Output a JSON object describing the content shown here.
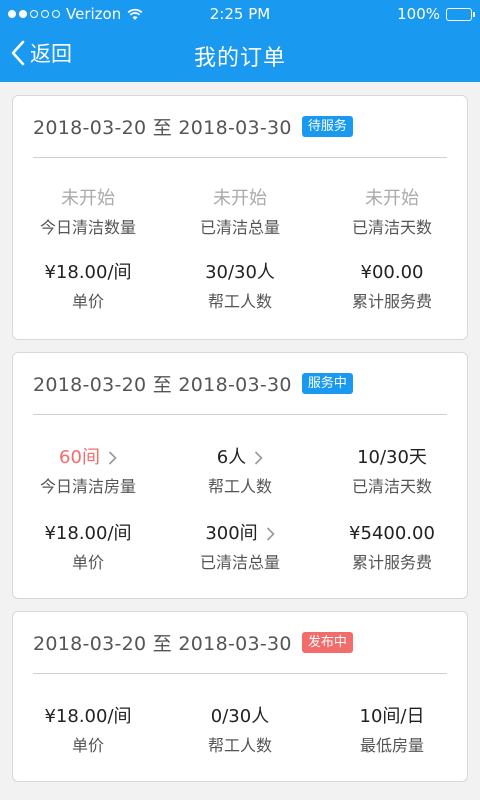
{
  "status_bar": {
    "carrier": "Verizon",
    "time": "2:25 PM",
    "battery": "100%",
    "signal_icon": "signal-dots-icon",
    "wifi_icon": "wifi-icon",
    "battery_icon": "battery-icon"
  },
  "nav": {
    "back_label": "返回",
    "title": "我的订单",
    "back_icon": "chevron-left-icon"
  },
  "colors": {
    "primary": "#1a99f0",
    "danger": "#f36c6c",
    "background": "#f2f2f2"
  },
  "orders": [
    {
      "date_range": "2018-03-20 至 2018-03-30",
      "status": "待服务",
      "status_color": "#1a99f0",
      "stats": [
        {
          "value": "未开始",
          "label": "今日清洁数量"
        },
        {
          "value": "未开始",
          "label": "已清洁总量"
        },
        {
          "value": "未开始",
          "label": "已清洁天数"
        },
        {
          "value": "¥18.00/间",
          "label": "单价"
        },
        {
          "value": "30/30人",
          "label": "帮工人数"
        },
        {
          "value": "¥00.00",
          "label": "累计服务费"
        }
      ]
    },
    {
      "date_range": "2018-03-20 至 2018-03-30",
      "status": "服务中",
      "status_color": "#1a99f0",
      "stats": [
        {
          "value": "60间",
          "label": "今日清洁房量"
        },
        {
          "value": "6人",
          "label": "帮工人数"
        },
        {
          "value": "10/30天",
          "label": "已清洁天数"
        },
        {
          "value": "¥18.00/间",
          "label": "单价"
        },
        {
          "value": "300间",
          "label": "已清洁总量"
        },
        {
          "value": "¥5400.00",
          "label": "累计服务费"
        }
      ]
    },
    {
      "date_range": "2018-03-20 至 2018-03-30",
      "status": "发布中",
      "status_color": "#f36c6c",
      "stats": [
        {
          "value": "¥18.00/间",
          "label": "单价"
        },
        {
          "value": "0/30人",
          "label": "帮工人数"
        },
        {
          "value": "10间/日",
          "label": "最低房量"
        }
      ]
    }
  ]
}
